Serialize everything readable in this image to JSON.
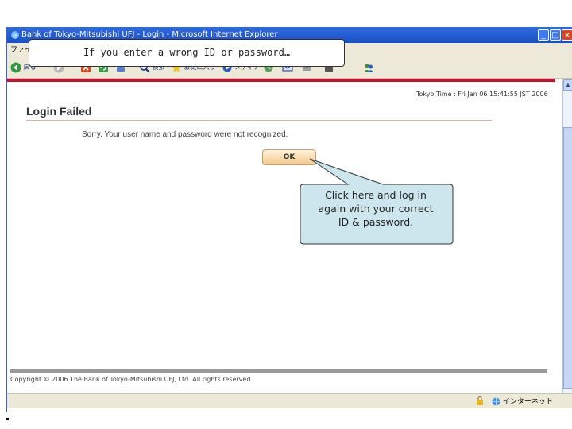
{
  "window": {
    "title": "Bank of Tokyo-Mitsubishi UFJ - Login - Microsoft Internet Explorer",
    "controls": {
      "minimize": "_",
      "maximize": "□",
      "close": "×"
    }
  },
  "menubar": {
    "file": "ファイル"
  },
  "toolbar": {
    "back": "戻る",
    "search": "検索",
    "favorites": "お気に入り",
    "media": "メディア"
  },
  "page": {
    "tokyo_time": "Tokyo Time : Fri Jan 06 15:41:55 JST 2006",
    "heading": "Login Failed",
    "message": "Sorry. Your user name and password were not recognized.",
    "ok_label": "OK",
    "copyright": "Copyright © 2006 The Bank of Tokyo-Mitsubishi UFJ, Ltd. All rights reserved."
  },
  "statusbar": {
    "zone": "インターネット"
  },
  "annotations": {
    "top_callout": "If you enter a wrong ID or password…",
    "bubble_line1": "Click here and log in",
    "bubble_line2": "again with your correct",
    "bubble_line3": "ID & password."
  },
  "colors": {
    "titlebar": "#1a4fc4",
    "bank_red": "#c8102e",
    "bubble_fill": "#cde6ee",
    "ok_button": "#f4c98c"
  }
}
